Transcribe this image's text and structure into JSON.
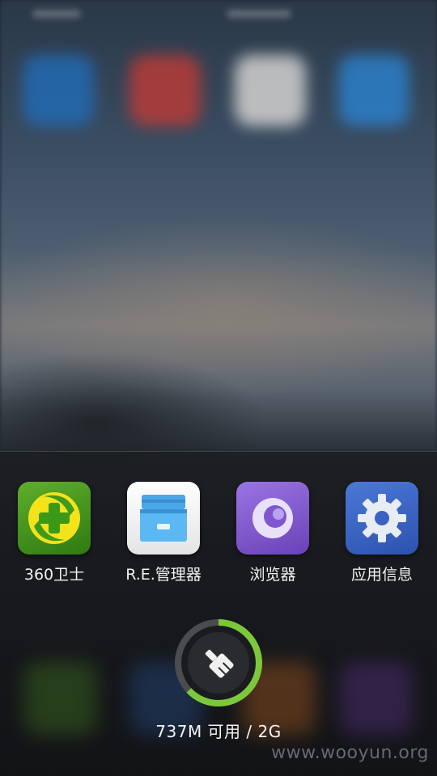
{
  "recent_apps": [
    {
      "label": "360卫士",
      "icon": "360-security-icon",
      "color": "#3f8f1e"
    },
    {
      "label": "R.E.管理器",
      "icon": "re-file-manager-icon",
      "color": "#f0f0f0"
    },
    {
      "label": "浏览器",
      "icon": "browser-icon",
      "color": "#7a52c8"
    },
    {
      "label": "应用信息",
      "icon": "app-info-settings-icon",
      "color": "#3b62c4"
    }
  ],
  "memory": {
    "text": "737M 可用 / 2G",
    "used_fraction": 0.63,
    "ring_color": "#7cc83a"
  },
  "watermark": "www.wooyun.org"
}
